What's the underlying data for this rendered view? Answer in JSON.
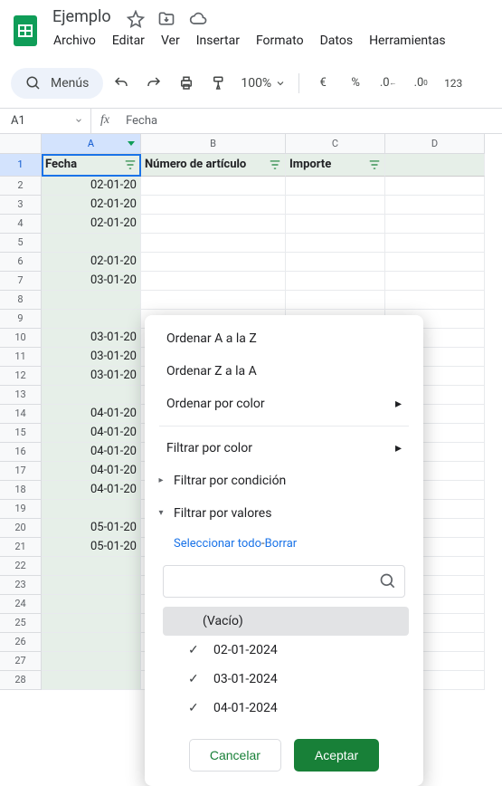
{
  "doc": {
    "name": "Ejemplo"
  },
  "menus": {
    "file": "Archivo",
    "edit": "Editar",
    "view": "Ver",
    "insert": "Insertar",
    "format": "Formato",
    "data": "Datos",
    "tools": "Herramientas"
  },
  "toolbar": {
    "menus_label": "Menús",
    "zoom": "100%"
  },
  "namebox": {
    "ref": "A1"
  },
  "formula": {
    "value": "Fecha"
  },
  "columns": {
    "A": "A",
    "B": "B",
    "C": "C",
    "D": "D",
    "wA": 110,
    "wB": 160,
    "wC": 110,
    "wD": 110
  },
  "headers": {
    "A": "Fecha",
    "B": "Número de artículo",
    "C": "Importe"
  },
  "rows": [
    {
      "n": 1,
      "a": "Fecha",
      "hdr": true
    },
    {
      "n": 2,
      "a": "02-01-20"
    },
    {
      "n": 3,
      "a": "02-01-20"
    },
    {
      "n": 4,
      "a": "02-01-20"
    },
    {
      "n": 5,
      "a": ""
    },
    {
      "n": 6,
      "a": "02-01-20"
    },
    {
      "n": 7,
      "a": "03-01-20"
    },
    {
      "n": 8,
      "a": ""
    },
    {
      "n": 9,
      "a": ""
    },
    {
      "n": 10,
      "a": "03-01-20"
    },
    {
      "n": 11,
      "a": "03-01-20"
    },
    {
      "n": 12,
      "a": "03-01-20"
    },
    {
      "n": 13,
      "a": ""
    },
    {
      "n": 14,
      "a": "04-01-20"
    },
    {
      "n": 15,
      "a": "04-01-20"
    },
    {
      "n": 16,
      "a": "04-01-20"
    },
    {
      "n": 17,
      "a": "04-01-20"
    },
    {
      "n": 18,
      "a": "04-01-20"
    },
    {
      "n": 19,
      "a": ""
    },
    {
      "n": 20,
      "a": "05-01-20"
    },
    {
      "n": 21,
      "a": "05-01-20"
    },
    {
      "n": 22,
      "a": ""
    },
    {
      "n": 23,
      "a": ""
    },
    {
      "n": 24,
      "a": ""
    },
    {
      "n": 25,
      "a": ""
    },
    {
      "n": 26,
      "a": ""
    },
    {
      "n": 27,
      "a": ""
    },
    {
      "n": 28,
      "a": ""
    }
  ],
  "filter": {
    "sort_az": "Ordenar A a la Z",
    "sort_za": "Ordenar Z a la A",
    "sort_color": "Ordenar por color",
    "filter_color": "Filtrar por color",
    "filter_condition": "Filtrar por condición",
    "filter_values": "Filtrar por valores",
    "select_all": "Seleccionar todo",
    "dash": "-",
    "clear": "Borrar",
    "empty_label": "(Vacío)",
    "values": [
      "02-01-2024",
      "03-01-2024",
      "04-01-2024"
    ],
    "cancel": "Cancelar",
    "ok": "Aceptar"
  }
}
